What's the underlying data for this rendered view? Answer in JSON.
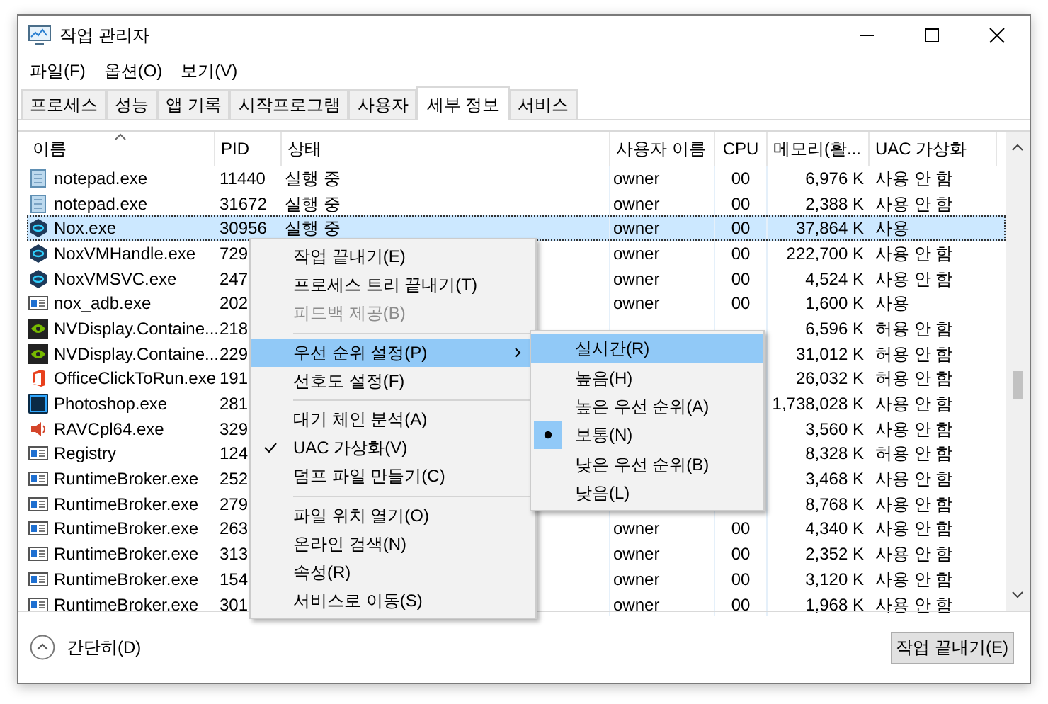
{
  "window": {
    "title": "작업 관리자"
  },
  "menu_bar": [
    "파일(F)",
    "옵션(O)",
    "보기(V)"
  ],
  "tabs": [
    {
      "label": "프로세스",
      "selected": false
    },
    {
      "label": "성능",
      "selected": false
    },
    {
      "label": "앱 기록",
      "selected": false
    },
    {
      "label": "시작프로그램",
      "selected": false
    },
    {
      "label": "사용자",
      "selected": false
    },
    {
      "label": "세부 정보",
      "selected": true
    },
    {
      "label": "서비스",
      "selected": false
    }
  ],
  "table": {
    "columns": [
      "이름",
      "PID",
      "상태",
      "사용자 이름",
      "CPU",
      "메모리(활...",
      "UAC 가상화"
    ],
    "rows": [
      {
        "kind": "notepad",
        "selected": false,
        "name": "notepad.exe",
        "pid": "11440",
        "status": "실행 중",
        "user": "owner",
        "cpu": "00",
        "memory": "6,976 K",
        "uac": "사용 안 함"
      },
      {
        "kind": "notepad",
        "selected": false,
        "name": "notepad.exe",
        "pid": "31672",
        "status": "실행 중",
        "user": "owner",
        "cpu": "00",
        "memory": "2,388 K",
        "uac": "사용 안 함"
      },
      {
        "kind": "nox",
        "selected": true,
        "name": "Nox.exe",
        "pid": "30956",
        "status": "실행 중",
        "user": "owner",
        "cpu": "00",
        "memory": "37,864 K",
        "uac": "사용"
      },
      {
        "kind": "nox",
        "selected": false,
        "name": "NoxVMHandle.exe",
        "pid": "729",
        "user": "owner",
        "cpu": "00",
        "memory": "222,700 K",
        "uac": "사용 안 함"
      },
      {
        "kind": "nox",
        "selected": false,
        "name": "NoxVMSVC.exe",
        "pid": "247",
        "user": "owner",
        "cpu": "00",
        "memory": "4,524 K",
        "uac": "사용 안 함"
      },
      {
        "kind": "app",
        "selected": false,
        "name": "nox_adb.exe",
        "pid": "202",
        "user": "owner",
        "cpu": "00",
        "memory": "1,600 K",
        "uac": "사용"
      },
      {
        "kind": "nvidia",
        "selected": false,
        "name": "NVDisplay.Containe...",
        "pid": "218",
        "memory": "6,596 K",
        "uac": "허용 안 함"
      },
      {
        "kind": "nvidia",
        "selected": false,
        "name": "NVDisplay.Containe...",
        "pid": "229",
        "memory": "31,012 K",
        "uac": "허용 안 함"
      },
      {
        "kind": "office",
        "selected": false,
        "name": "OfficeClickToRun.exe",
        "pid": "191",
        "memory": "26,032 K",
        "uac": "허용 안 함"
      },
      {
        "kind": "photoshop",
        "selected": false,
        "name": "Photoshop.exe",
        "pid": "281",
        "memory": "1,738,028 K",
        "uac": "사용 안 함"
      },
      {
        "kind": "speaker",
        "selected": false,
        "name": "RAVCpl64.exe",
        "pid": "329",
        "memory": "3,560 K",
        "uac": "사용 안 함"
      },
      {
        "kind": "app",
        "selected": false,
        "name": "Registry",
        "pid": "124",
        "memory": "8,328 K",
        "uac": "허용 안 함"
      },
      {
        "kind": "app",
        "selected": false,
        "name": "RuntimeBroker.exe",
        "pid": "252",
        "memory": "3,468 K",
        "uac": "사용 안 함"
      },
      {
        "kind": "app",
        "selected": false,
        "name": "RuntimeBroker.exe",
        "pid": "279",
        "memory": "8,768 K",
        "uac": "사용 안 함"
      },
      {
        "kind": "app",
        "selected": false,
        "name": "RuntimeBroker.exe",
        "pid": "263",
        "user": "owner",
        "cpu": "00",
        "memory": "4,340 K",
        "uac": "사용 안 함"
      },
      {
        "kind": "app",
        "selected": false,
        "name": "RuntimeBroker.exe",
        "pid": "313",
        "user": "owner",
        "cpu": "00",
        "memory": "2,352 K",
        "uac": "사용 안 함"
      },
      {
        "kind": "app",
        "selected": false,
        "name": "RuntimeBroker.exe",
        "pid": "154",
        "user": "owner",
        "cpu": "00",
        "memory": "3,120 K",
        "uac": "사용 안 함"
      },
      {
        "kind": "app",
        "selected": false,
        "name": "RuntimeBroker.exe",
        "pid": "301",
        "user": "owner",
        "cpu": "00",
        "memory": "1,968 K",
        "uac": "사용 안 함"
      }
    ]
  },
  "context_menu": [
    {
      "kind": "item",
      "label": "작업 끝내기(E)",
      "disabled": false,
      "selected": false,
      "checked": false,
      "submenu": false
    },
    {
      "kind": "item",
      "label": "프로세스 트리 끝내기(T)",
      "disabled": false,
      "selected": false,
      "checked": false,
      "submenu": false
    },
    {
      "kind": "item",
      "label": "피드백 제공(B)",
      "disabled": true,
      "selected": false,
      "checked": false,
      "submenu": false
    },
    {
      "kind": "separator"
    },
    {
      "kind": "item",
      "label": "우선 순위 설정(P)",
      "disabled": false,
      "selected": true,
      "checked": false,
      "submenu": true
    },
    {
      "kind": "item",
      "label": "선호도 설정(F)",
      "disabled": false,
      "selected": false,
      "checked": false,
      "submenu": false
    },
    {
      "kind": "separator"
    },
    {
      "kind": "item",
      "label": "대기 체인 분석(A)",
      "disabled": false,
      "selected": false,
      "checked": false,
      "submenu": false
    },
    {
      "kind": "item",
      "label": "UAC 가상화(V)",
      "disabled": false,
      "selected": false,
      "checked": true,
      "submenu": false
    },
    {
      "kind": "item",
      "label": "덤프 파일 만들기(C)",
      "disabled": false,
      "selected": false,
      "checked": false,
      "submenu": false
    },
    {
      "kind": "separator"
    },
    {
      "kind": "item",
      "label": "파일 위치 열기(O)",
      "disabled": false,
      "selected": false,
      "checked": false,
      "submenu": false
    },
    {
      "kind": "item",
      "label": "온라인 검색(N)",
      "disabled": false,
      "selected": false,
      "checked": false,
      "submenu": false
    },
    {
      "kind": "item",
      "label": "속성(R)",
      "disabled": false,
      "selected": false,
      "checked": false,
      "submenu": false
    },
    {
      "kind": "item",
      "label": "서비스로 이동(S)",
      "disabled": false,
      "selected": false,
      "checked": false,
      "submenu": false
    }
  ],
  "priority_submenu": [
    {
      "label": "실시간(R)",
      "selected": true,
      "checked": false
    },
    {
      "label": "높음(H)",
      "selected": false,
      "checked": false
    },
    {
      "label": "높은 우선 순위(A)",
      "selected": false,
      "checked": false
    },
    {
      "label": "보통(N)",
      "selected": false,
      "checked": true
    },
    {
      "label": "낮은 우선 순위(B)",
      "selected": false,
      "checked": false
    },
    {
      "label": "낮음(L)",
      "selected": false,
      "checked": false
    }
  ],
  "footer": {
    "collapse_label": "간단히(D)",
    "end_task_button": "작업 끝내기(E)"
  }
}
